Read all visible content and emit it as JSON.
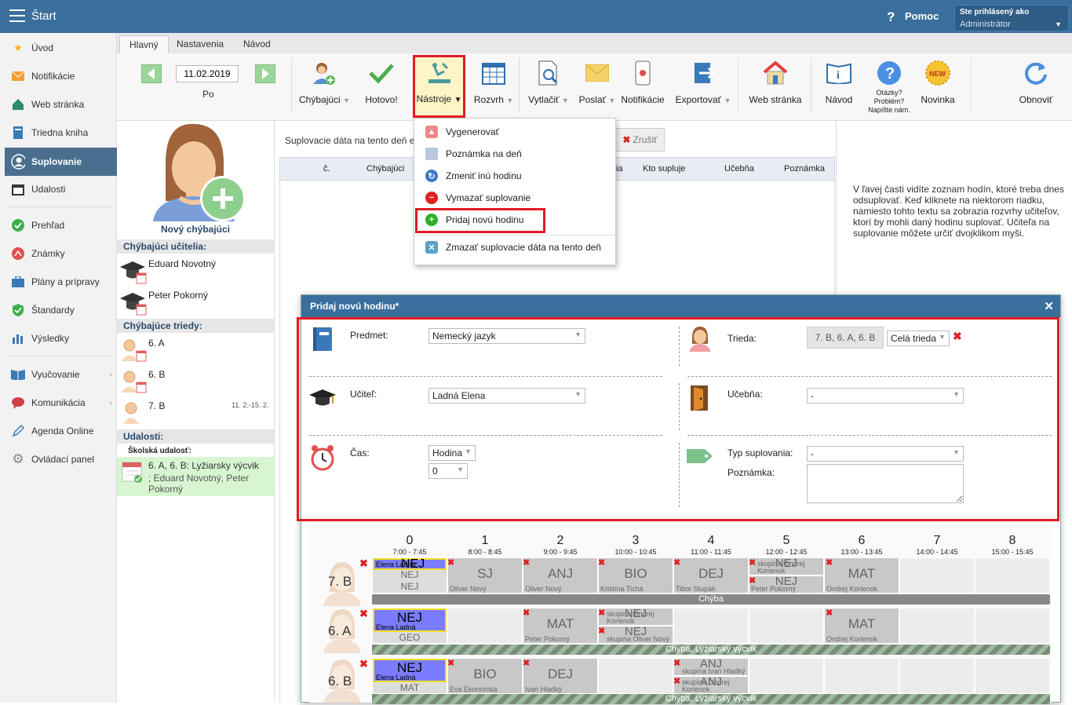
{
  "topbar": {
    "title": "Štart",
    "help": "Pomoc",
    "user_line1": "Ste prihlásený ako",
    "user_line2": "Administrátor"
  },
  "sidebar": {
    "items": [
      {
        "label": "Úvod",
        "icon": "star-icon"
      },
      {
        "label": "Notifikácie",
        "icon": "envelope-icon"
      },
      {
        "label": "Web stránka",
        "icon": "home-icon"
      },
      {
        "label": "Triedna kniha",
        "icon": "book-icon"
      },
      {
        "label": "Suplovanie",
        "icon": "user-icon"
      },
      {
        "label": "Udalosti",
        "icon": "calendar-icon"
      },
      {
        "label": "Prehľad",
        "icon": "check-icon"
      },
      {
        "label": "Známky",
        "icon": "grades-icon"
      },
      {
        "label": "Plány a prípravy",
        "icon": "briefcase-icon"
      },
      {
        "label": "Štandardy",
        "icon": "shield-icon"
      },
      {
        "label": "Výsledky",
        "icon": "chart-icon"
      },
      {
        "label": "Vyučovanie",
        "icon": "book-open-icon"
      },
      {
        "label": "Komunikácia",
        "icon": "chat-icon"
      },
      {
        "label": "Agenda Online",
        "icon": "pen-icon"
      },
      {
        "label": "Ovládací panel",
        "icon": "gear-icon"
      }
    ]
  },
  "tabs": [
    "Hlavný",
    "Nastavenia",
    "Návod"
  ],
  "ribbon": {
    "date": "11.02.2019",
    "day": "Po",
    "absent": "Chýbajúci",
    "done": "Hotovo!",
    "tools": "Nástroje",
    "timetable": "Rozvrh",
    "print": "Vytlačiť",
    "send": "Poslať",
    "notifications": "Notifikácie",
    "export": "Exportovať",
    "web": "Web stránka",
    "guide": "Návod",
    "questions": "Otázky? Problém? Napíšte nám.",
    "news": "Novinka",
    "refresh": "Obnoviť"
  },
  "leftpanel": {
    "new_absent": "Nový chýbajúci",
    "teachers_header": "Chýbajúci učitelia:",
    "teachers": [
      "Eduard Novotný",
      "Peter Pokorný"
    ],
    "classes_header": "Chýbajúce triedy:",
    "classes": [
      "6. A",
      "6. B",
      "7. B"
    ],
    "class_7b_date": "11. 2.-15. 2.",
    "events_header": "Udalosti:",
    "event_type": "Školská udalosť:",
    "event_title": "6. A, 6. B: Lyžiarsky výcvik",
    "event_people": "; Eduard Novotný, Peter Pokorný"
  },
  "main": {
    "info": "Suplovacie dáta na tento deň e",
    "cancel": "Zrušiť",
    "cols": [
      "č.",
      "Chýbajúci",
      "Kto supluje",
      "Učebňa",
      "Poznámka"
    ],
    "cols_partial": "ia"
  },
  "right_text": "V ľavej časti vidíte zoznam hodín, ktoré treba dnes odsuplovať. Keď kliknete na niektorom riadku, namiesto tohto textu sa zobrazia rozvrhy učiteľov, ktorí by mohli daný hodinu suplovať. Učiteľa na suplovanie môžete určiť dvojklikom myši.",
  "dropdown": [
    {
      "label": "Vygenerovať",
      "color": "#e05050"
    },
    {
      "label": "Poznámka na deň",
      "color": "#9ab"
    },
    {
      "label": "Zmeniť inú hodinu",
      "color": "#3a78c8"
    },
    {
      "label": "Vymazať suplovanie",
      "color": "#e02020"
    },
    {
      "label": "Pridaj novú hodinu",
      "color": "#2cb02c"
    },
    {
      "label": "Zmazať suplovacie dáta na tento deň",
      "color": "#5aa0c8"
    }
  ],
  "dialog": {
    "title": "Pridaj novú hodinu*",
    "subject_label": "Predmet:",
    "subject": "Nemecký jazyk",
    "class_label": "Trieda:",
    "class_value": "7. B, 6. A, 6. B",
    "class_scope": "Celá trieda",
    "teacher_label": "Učiteľ:",
    "teacher": "Ladná Elena",
    "room_label": "Učebňa:",
    "room": "-",
    "time_label": "Čas:",
    "time_unit": "Hodina",
    "time_value": "0",
    "type_label": "Typ suplovania:",
    "type": "-",
    "note_label": "Poznámka:"
  },
  "timetable": {
    "periods": [
      {
        "n": "0",
        "t": "7:00 - 7:45"
      },
      {
        "n": "1",
        "t": "8:00 - 8:45"
      },
      {
        "n": "2",
        "t": "9:00 - 9:45"
      },
      {
        "n": "3",
        "t": "10:00 - 10:45"
      },
      {
        "n": "4",
        "t": "11:00 - 11:45"
      },
      {
        "n": "5",
        "t": "12:00 - 12:45"
      },
      {
        "n": "6",
        "t": "13:00 - 13:45"
      },
      {
        "n": "7",
        "t": "14:00 - 14:45"
      },
      {
        "n": "8",
        "t": "15:00 - 15:45"
      }
    ],
    "rows": [
      {
        "label": "7. B",
        "bar": "Chýba"
      },
      {
        "label": "6. A",
        "bar": "Chýba, Lyžiarsky výcvik"
      },
      {
        "label": "6. B",
        "bar": "Chýba, Lyžiarsky výcvik"
      }
    ],
    "cells": {
      "r1_new": "NEJ",
      "r1_new_t": "Elena Ladná",
      "r1_a": "NEJ",
      "r1_b": "NEJ",
      "r1_p1": "SJ",
      "r1_p1_t": "Oliver Nový",
      "r1_p2": "ANJ",
      "r1_p2_t": "Oliver Nový",
      "r1_p3": "BIO",
      "r1_p3_t": "Kristína Tichá",
      "r1_p4": "DEJ",
      "r1_p4_t": "Tibor Stupák",
      "r1_p5a": "NEJ",
      "r1_p5a_t": "skupina Ondrej Korienok",
      "r1_p5b": "NEJ",
      "r1_p5b_t": "Peter Pokorný",
      "r1_p6": "MAT",
      "r1_p6_t": "Ondrej Korienok",
      "r2_new": "NEJ",
      "r2_new_t": "Elena Ladná",
      "r2_a": "GEO",
      "r2_p2": "MAT",
      "r2_p2_t": "Peter Pokorný",
      "r2_p3a": "NEJ",
      "r2_p3a_t": "skupina Ondrej Korienok",
      "r2_p3b": "NEJ",
      "r2_p3b_t": "skupina Oliver Nový",
      "r2_p6": "MAT",
      "r2_p6_t": "Ondrej Korienok",
      "r3_new": "NEJ",
      "r3_new_t": "Elena Ladná",
      "r3_a": "MAT",
      "r3_p1": "BIO",
      "r3_p1_t": "Eva Ekonómka",
      "r3_p2": "DEJ",
      "r3_p2_t": "Ivan Hladký",
      "r3_p4a": "ANJ",
      "r3_p4a_t": "skupina Ivan Hladký",
      "r3_p4b": "ANJ",
      "r3_p4b_t": "skupina Ondrej Korienok"
    }
  }
}
